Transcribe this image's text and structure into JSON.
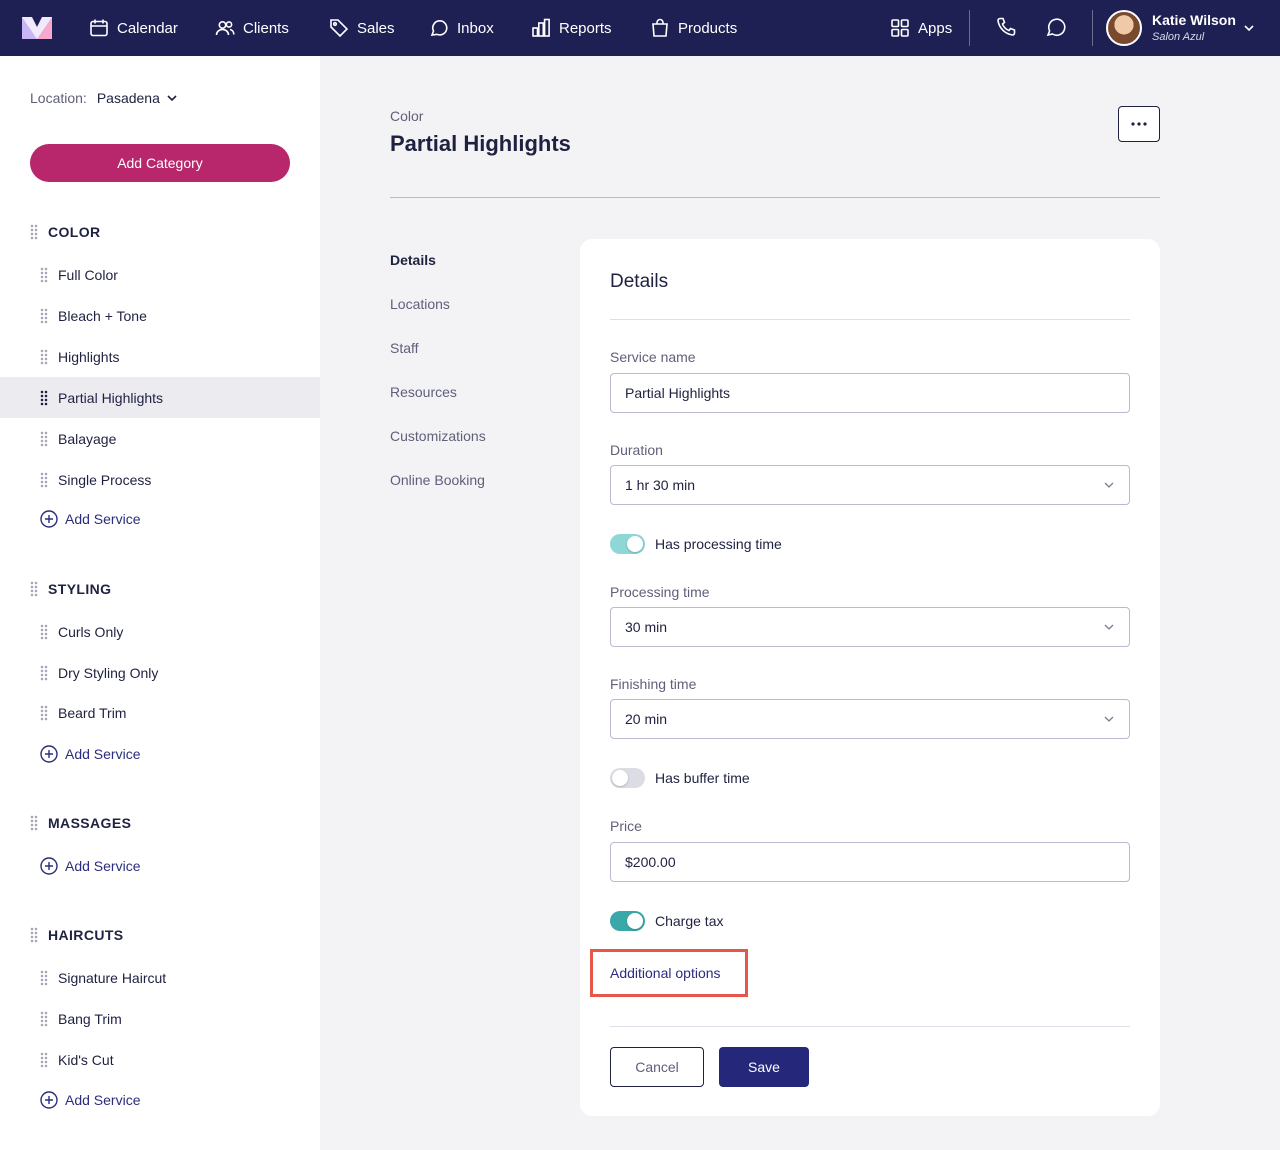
{
  "nav": {
    "items": [
      {
        "label": "Calendar",
        "icon": "calendar-icon"
      },
      {
        "label": "Clients",
        "icon": "users-icon"
      },
      {
        "label": "Sales",
        "icon": "tag-icon"
      },
      {
        "label": "Inbox",
        "icon": "chat-bubble-icon"
      },
      {
        "label": "Reports",
        "icon": "bar-chart-icon"
      },
      {
        "label": "Products",
        "icon": "shopping-bag-icon"
      }
    ],
    "apps_label": "Apps",
    "user_name": "Katie Wilson",
    "user_salon": "Salon Azul"
  },
  "sidebar": {
    "location_label": "Location:",
    "location_value": "Pasadena",
    "add_category": "Add Category",
    "add_service": "Add Service",
    "categories": [
      {
        "name": "COLOR",
        "services": [
          "Full Color",
          "Bleach + Tone",
          "Highlights",
          "Partial Highlights",
          "Balayage",
          "Single Process"
        ]
      },
      {
        "name": "STYLING",
        "services": [
          "Curls Only",
          "Dry Styling Only",
          "Beard Trim"
        ]
      },
      {
        "name": "MASSAGES",
        "services": []
      },
      {
        "name": "HAIRCUTS",
        "services": [
          "Signature Haircut",
          "Bang Trim",
          "Kid's Cut"
        ]
      }
    ],
    "active_service": "Partial Highlights"
  },
  "page": {
    "breadcrumb": "Color",
    "title": "Partial Highlights",
    "subnav": [
      "Details",
      "Locations",
      "Staff",
      "Resources",
      "Customizations",
      "Online Booking"
    ]
  },
  "form": {
    "card_title": "Details",
    "service_name_label": "Service name",
    "service_name_value": "Partial Highlights",
    "duration_label": "Duration",
    "duration_value": "1 hr 30 min",
    "processing_toggle_label": "Has processing time",
    "processing_label": "Processing time",
    "processing_value": "30 min",
    "finishing_label": "Finishing time",
    "finishing_value": "20 min",
    "buffer_toggle_label": "Has buffer time",
    "price_label": "Price",
    "price_value": "$200.00",
    "tax_toggle_label": "Charge tax",
    "additional_options": "Additional options",
    "cancel": "Cancel",
    "save": "Save",
    "toggles": {
      "processing": true,
      "buffer": false,
      "tax": true
    }
  },
  "colors": {
    "nav_bg": "#1e2054",
    "accent_pink": "#b8266b",
    "primary": "#25287a",
    "teal": "#3aa8a8",
    "highlight_box": "#e5574a"
  }
}
